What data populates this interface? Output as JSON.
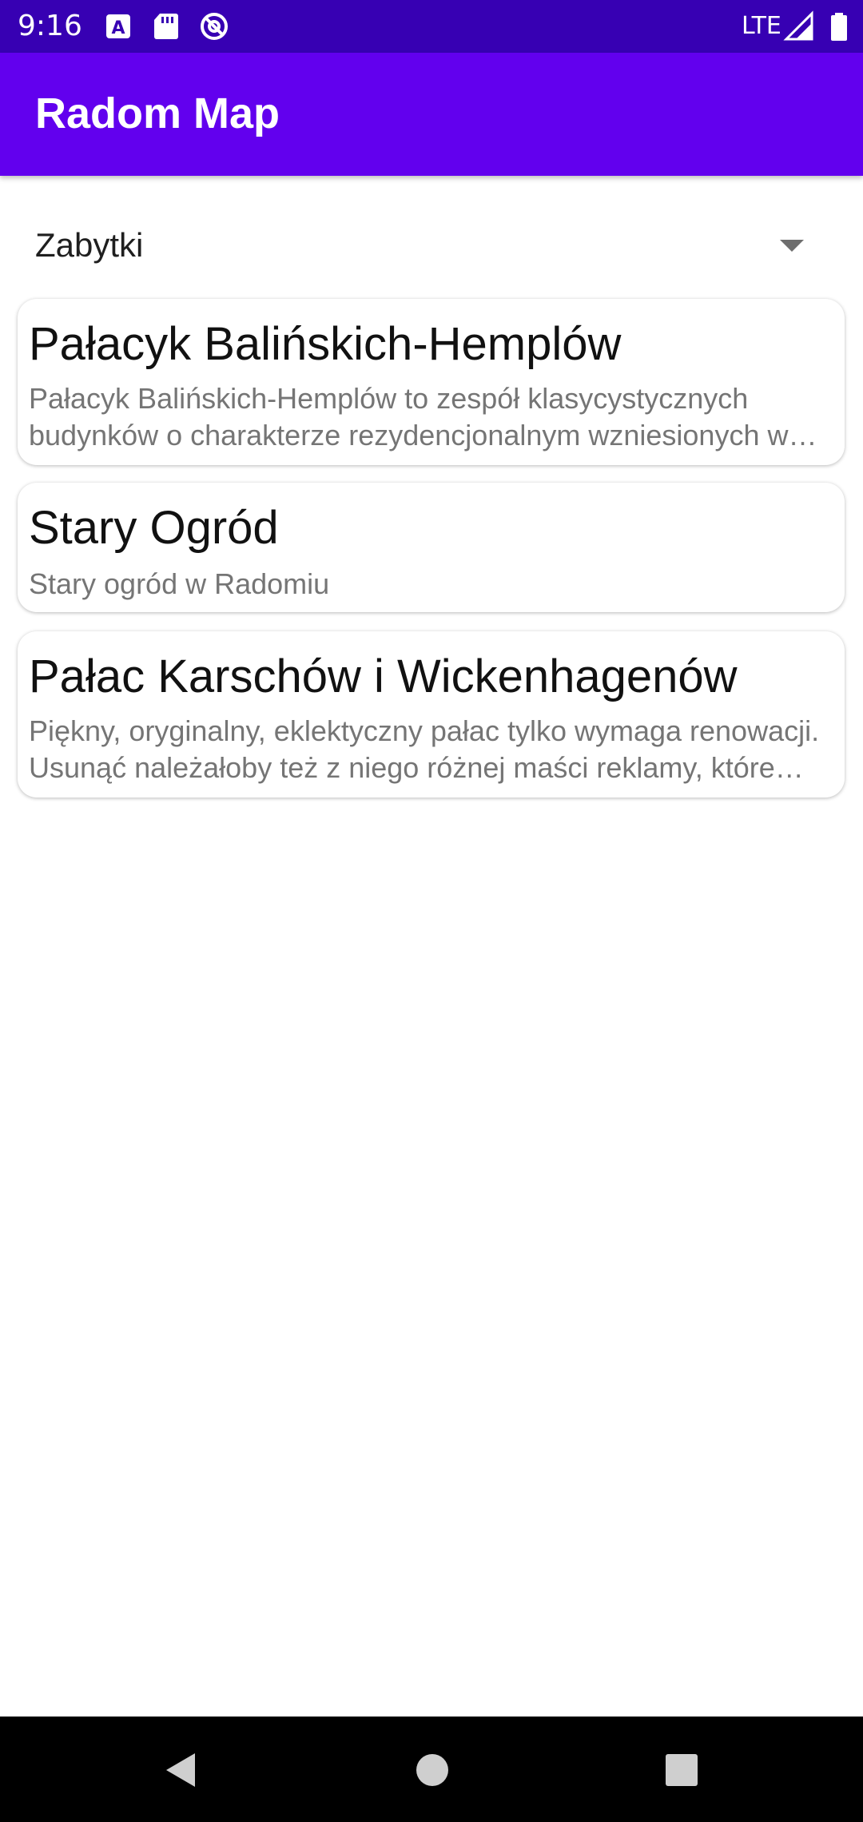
{
  "status_bar": {
    "time": "9:16",
    "network": "LTE",
    "icons": [
      "a-notification-icon",
      "sd-card-icon",
      "no-disturb-icon",
      "signal-icon",
      "battery-icon"
    ]
  },
  "app_bar": {
    "title": "Radom Map"
  },
  "category_spinner": {
    "selected": "Zabytki"
  },
  "places": [
    {
      "title": "Pałacyk Balińskich-Hemplów",
      "description": "Pałacyk Balińskich-Hemplów to zespół klasycystycznych budynków o charakterze rezydencjonalnym wzniesionych w XIX wieku przy ulicy Malczewskiego w Radomiu."
    },
    {
      "title": "Stary Ogród",
      "description": "Stary ogród w Radomiu"
    },
    {
      "title": "Pałac Karschów i Wickenhagenów",
      "description": "Piękny, oryginalny, eklektyczny pałac tylko wymaga renowacji. Usunąć należałoby też z niego różnej maści reklamy, które szpecą elewację budynku."
    }
  ],
  "colors": {
    "status_bar": "#3700b3",
    "app_bar": "#6200ee",
    "title_text": "#111111",
    "description_text": "#757575"
  }
}
